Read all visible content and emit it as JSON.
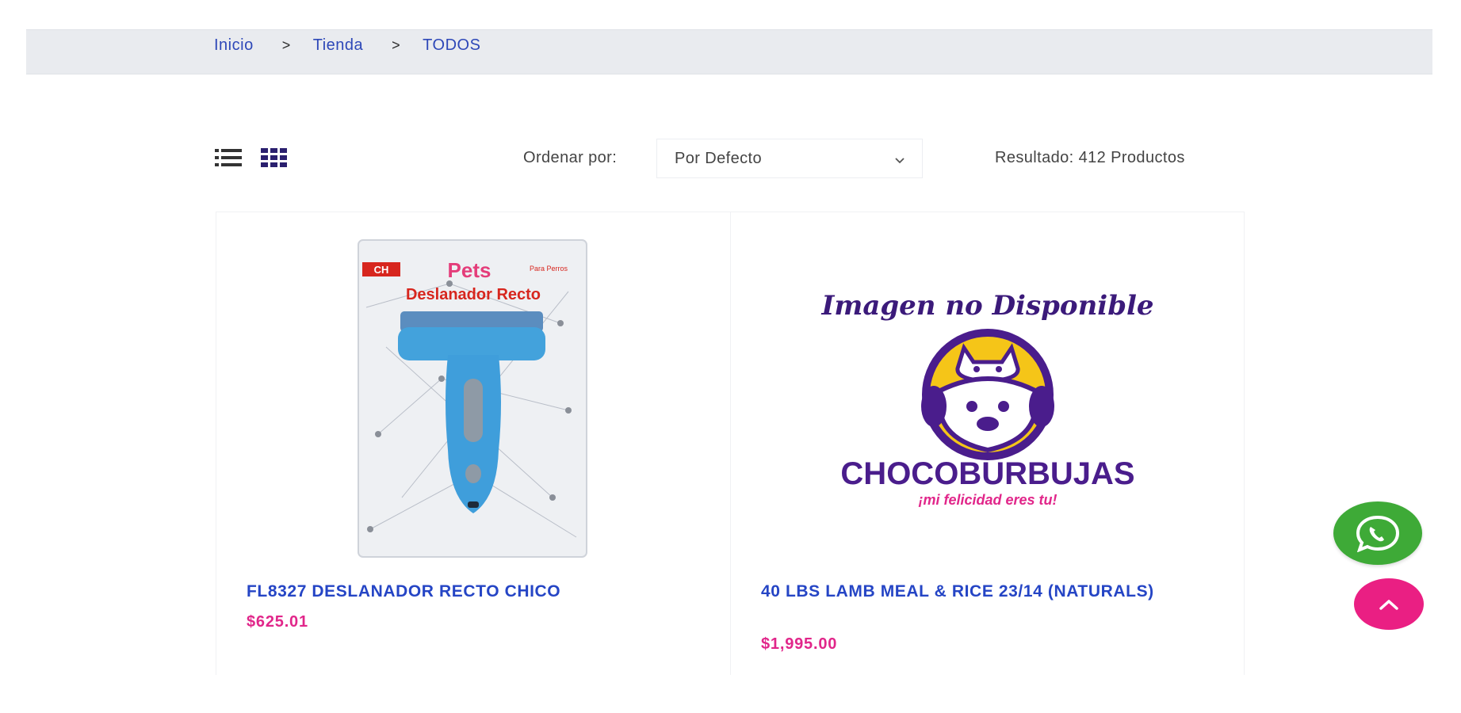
{
  "breadcrumb": {
    "items": [
      "Inicio",
      "Tienda",
      "TODOS"
    ],
    "separator": ">"
  },
  "toolbar": {
    "list_view_icon": "list-icon",
    "grid_view_icon": "grid-icon",
    "sort_label": "Ordenar por:",
    "sort_selected": "Por Defecto",
    "result_count": "Resultado: 412 Productos"
  },
  "products": [
    {
      "title": "FL8327 DESLANADOR RECTO CHICO",
      "price": "$625.01",
      "image": {
        "type": "product-photo",
        "package_brand": "Pets",
        "package_label": "Deslanador Recto",
        "package_badge": "CH",
        "package_corner": "Para Perros"
      }
    },
    {
      "title": "40 LBS LAMB MEAL & RICE 23/14 (NATURALS)",
      "price": "$1,995.00",
      "image": {
        "type": "placeholder",
        "caption": "Imagen no Disponible",
        "brand": "CHOCOBURBUJAS",
        "tagline": "¡mi felicidad eres tu!"
      }
    }
  ],
  "floating": {
    "whatsapp_icon": "whatsapp-icon",
    "scroll_top_icon": "chevron-up-icon"
  },
  "colors": {
    "link_blue": "#2545c5",
    "price_pink": "#e1268a",
    "whatsapp_green": "#3eaa37",
    "scroll_top_pink": "#ea1f83",
    "brand_purple": "#4a1d8c",
    "brand_yellow": "#f5c518"
  }
}
